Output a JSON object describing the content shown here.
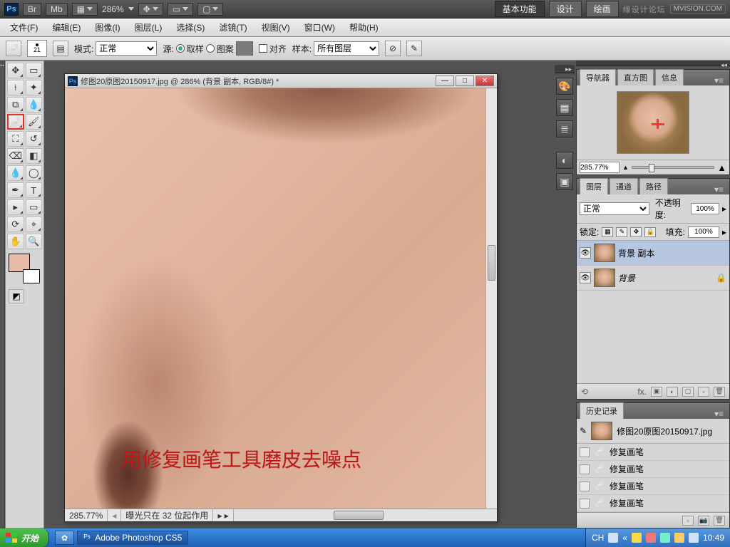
{
  "appbar": {
    "zoom": "286%",
    "br": "Br",
    "mb": "Mb",
    "workspaces": {
      "basic": "基本功能",
      "design": "设计",
      "paint": "绘画"
    },
    "brand": "缘设计论坛",
    "brand_badge": "MVISION.COM"
  },
  "menu": {
    "file": "文件(F)",
    "edit": "编辑(E)",
    "image": "图像(I)",
    "layer": "图层(L)",
    "select": "选择(S)",
    "filter": "滤镜(T)",
    "view": "视图(V)",
    "window": "窗口(W)",
    "help": "帮助(H)"
  },
  "options": {
    "brush_size": "21",
    "mode_label": "模式:",
    "mode_value": "正常",
    "source_label": "源:",
    "sample_opt": "取样",
    "pattern_opt": "图案",
    "aligned_label": "对齐",
    "sample_label": "样本:",
    "sample_value": "所有图层"
  },
  "document": {
    "title": "修图20原图20150917.jpg @ 286% (背景 副本, RGB/8#) *",
    "zoom": "285.77%",
    "status": "曝光只在 32 位起作用",
    "annotation": "用修复画笔工具磨皮去噪点"
  },
  "navigator": {
    "tabs": {
      "nav": "导航器",
      "hist": "直方图",
      "info": "信息"
    },
    "zoom": "285.77%"
  },
  "layers": {
    "tabs": {
      "layers": "图层",
      "channels": "通道",
      "paths": "路径"
    },
    "blend_value": "正常",
    "opacity_label": "不透明度:",
    "opacity_value": "100%",
    "lock_label": "锁定:",
    "fill_label": "填充:",
    "fill_value": "100%",
    "items": [
      {
        "name": "背景 副本",
        "locked": false
      },
      {
        "name": "背景",
        "locked": true
      }
    ],
    "foot_fx": "fx."
  },
  "history": {
    "tab": "历史记录",
    "snapshot": "修图20原图20150917.jpg",
    "step": "修复画笔",
    "items": [
      "修复画笔",
      "修复画笔",
      "修复画笔",
      "修复画笔"
    ]
  },
  "taskbar": {
    "start": "开始",
    "app": "Adobe Photoshop CS5",
    "ime": "CH",
    "time": "10:49"
  }
}
